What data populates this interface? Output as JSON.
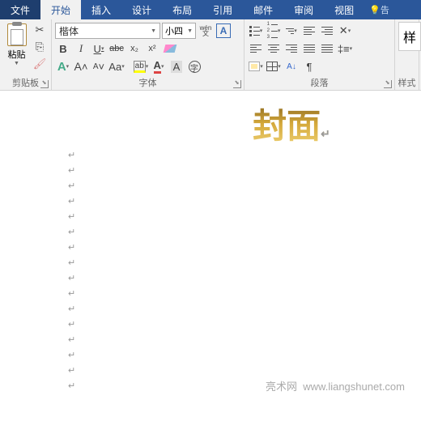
{
  "tabs": {
    "file": "文件",
    "home": "开始",
    "insert": "插入",
    "design": "设计",
    "layout": "布局",
    "ref": "引用",
    "mail": "邮件",
    "review": "审阅",
    "view": "视图",
    "tell": "告"
  },
  "clipboard": {
    "paste": "粘贴",
    "group": "剪贴板"
  },
  "font": {
    "name": "楷体",
    "size": "小四",
    "group": "字体",
    "bold": "B",
    "italic": "I",
    "underline": "U",
    "strike": "abc",
    "sub": "x₂",
    "sup": "x²",
    "grow": "A",
    "shrink": "A",
    "case": "Aa",
    "phonetic": "wén",
    "charborder": "A",
    "highlight": "ab",
    "fontcolor": "A"
  },
  "para": {
    "group": "段落"
  },
  "styles": {
    "group": "样式",
    "normal": "样"
  },
  "doc": {
    "title": "封面"
  },
  "watermark": {
    "site": "亮术网",
    "url": "www.liangshunet.com"
  }
}
